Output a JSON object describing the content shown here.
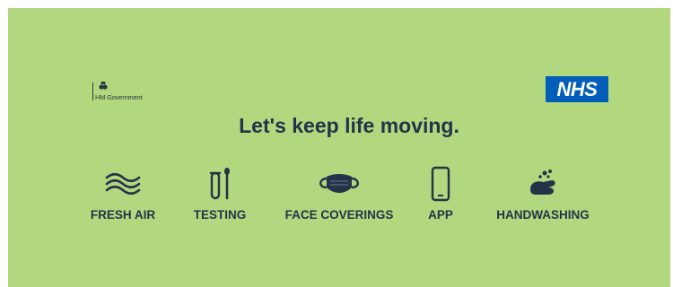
{
  "logo": {
    "government_text": "HM Government",
    "nhs_text": "NHS"
  },
  "headline": "Let's keep life moving.",
  "items": [
    {
      "label": "FRESH AIR",
      "icon": "air-waves-icon"
    },
    {
      "label": "TESTING",
      "icon": "test-tube-swab-icon"
    },
    {
      "label": "FACE COVERINGS",
      "icon": "face-mask-icon"
    },
    {
      "label": "APP",
      "icon": "smartphone-icon"
    },
    {
      "label": "HANDWASHING",
      "icon": "soapy-hands-icon"
    }
  ],
  "colors": {
    "background": "#b2d87f",
    "text": "#243348",
    "nhs_blue": "#005eb8"
  }
}
